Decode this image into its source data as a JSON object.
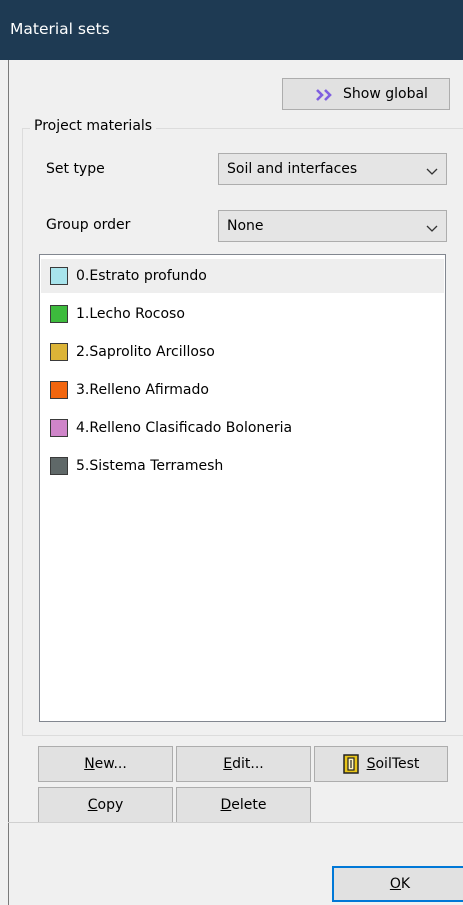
{
  "window": {
    "title": "Material sets"
  },
  "toolbar": {
    "show_global_label": "Show global",
    "show_global_icon": "double-chevron-right-icon"
  },
  "group": {
    "label": "Project materials"
  },
  "set_type": {
    "label": "Set type",
    "value": "Soil and interfaces"
  },
  "group_order": {
    "label": "Group order",
    "value": "None"
  },
  "materials": [
    {
      "label": "0.Estrato profundo",
      "color": "#a8e4ec",
      "selected": true
    },
    {
      "label": "1.Lecho Rocoso",
      "color": "#3dbb3d",
      "selected": false
    },
    {
      "label": "2.Saprolito Arcilloso",
      "color": "#dcb437",
      "selected": false
    },
    {
      "label": "3.Relleno Afirmado",
      "color": "#f2660f",
      "selected": false
    },
    {
      "label": "4.Relleno Clasificado Boloneria",
      "color": "#cf85c9",
      "selected": false
    },
    {
      "label": "5.Sistema Terramesh",
      "color": "#5f6868",
      "selected": false
    }
  ],
  "buttons": {
    "new": {
      "mnemonic": "N",
      "rest": "ew..."
    },
    "edit": {
      "mnemonic": "E",
      "rest": "dit..."
    },
    "soiltest": {
      "mnemonic": "S",
      "rest": "oilTest",
      "icon": "soiltest-icon"
    },
    "copy": {
      "mnemonic": "C",
      "rest": "opy"
    },
    "delete": {
      "mnemonic": "D",
      "rest": "elete"
    },
    "ok": {
      "mnemonic": "O",
      "rest": "K"
    }
  },
  "colors": {
    "titlebar": "#1e3a53",
    "accent": "#7f5fe0",
    "selection": "#eeeeee"
  }
}
